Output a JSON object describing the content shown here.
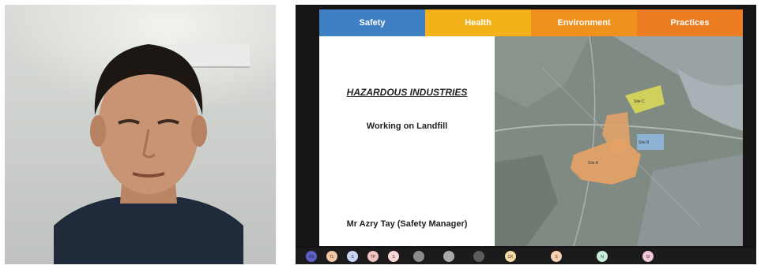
{
  "video_call": {
    "shared_slide": {
      "tabs": [
        {
          "label": "Safety",
          "color": "#3f7fc4"
        },
        {
          "label": "Health",
          "color": "#f3b21a"
        },
        {
          "label": "Environment",
          "color": "#f0901e"
        },
        {
          "label": "Practices",
          "color": "#ec7d22"
        }
      ],
      "heading": "HAZARDOUS INDUSTRIES",
      "subheading": "Working on Landfill",
      "presenter": "Mr Azry Tay (Safety Manager)"
    },
    "participants": [
      {
        "initials": "AN",
        "color": "#5b5fc7"
      },
      {
        "initials": "TL",
        "color": "#f5c6a5"
      },
      {
        "initials": "S",
        "color": "#c9d3f3"
      },
      {
        "initials": "TP",
        "color": "#f4c1c1"
      },
      {
        "initials": "S",
        "color": "#f8d6d6"
      },
      {
        "initials": "",
        "color": "#8a8c8e"
      },
      {
        "initials": "",
        "color": "#a7a9ab"
      },
      {
        "initials": "",
        "color": "#5a5c5e"
      },
      {
        "initials": "CK",
        "color": "#f7d9a8"
      },
      {
        "initials": "S",
        "color": "#f9d0b4"
      },
      {
        "initials": "N",
        "color": "#c7ecd7"
      },
      {
        "initials": "SI",
        "color": "#f3c5d8"
      }
    ]
  }
}
